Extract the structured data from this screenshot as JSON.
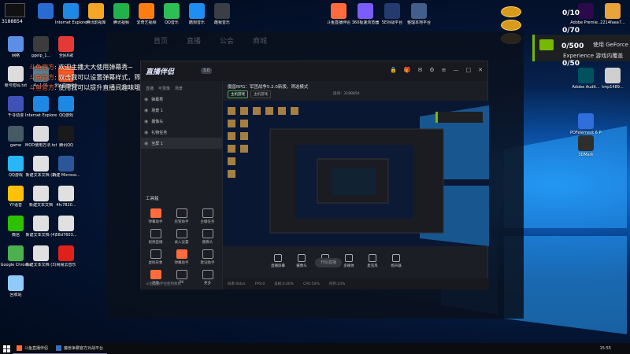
{
  "desktop": {
    "badge": "3188854",
    "left_icons": [
      {
        "label": "",
        "color": "#2a6bd1"
      },
      {
        "label": "Internet Explorer",
        "color": "#1e88e5"
      },
      {
        "label": "腾讯影视库",
        "color": "#f5a623"
      },
      {
        "label": "腾讯视频",
        "color": "#21b24c"
      },
      {
        "label": "爱奇艺视频",
        "color": "#ff7d0f"
      },
      {
        "label": "QQ音乐",
        "color": "#2cbf55"
      },
      {
        "label": "酷狗音乐",
        "color": "#1f8ef1"
      },
      {
        "label": "酷我音乐",
        "color": "#3a3f46"
      },
      {
        "label": "网络",
        "color": "#5c8ee6"
      },
      {
        "label": "ggelp_1...",
        "color": "#3c3c3c"
      },
      {
        "label": "全民K歌",
        "color": "#e53935"
      },
      {
        "label": "帐号密码.txt",
        "color": "#dcdcdc"
      },
      {
        "label": "4+1.91",
        "color": "#607d8b"
      },
      {
        "label": "全民直播助手",
        "color": "#ff5722"
      },
      {
        "label": "千寻动漫",
        "color": "#3f51b5"
      },
      {
        "label": "Internet Explorer",
        "color": "#1e88e5"
      },
      {
        "label": "QQ游戏",
        "color": "#1e88e5"
      },
      {
        "label": "game",
        "color": "#455a64"
      },
      {
        "label": "MOD使用方法.txt",
        "color": "#dcdcdc"
      },
      {
        "label": "腾讯QQ",
        "color": "#1a1a1a"
      },
      {
        "label": "QQ游戏",
        "color": "#29b6f6"
      },
      {
        "label": "新建文本文档 (2)",
        "color": "#e0e0e0"
      },
      {
        "label": "新建 Microso...",
        "color": "#2b579a"
      },
      {
        "label": "YY语音",
        "color": "#ffc107"
      },
      {
        "label": "新建文本文档",
        "color": "#e0e0e0"
      },
      {
        "label": "4fc7820...",
        "color": "#e0e0e0"
      },
      {
        "label": "微信",
        "color": "#2dc100"
      },
      {
        "label": "新建文本文档 (4)",
        "color": "#e0e0e0"
      },
      {
        "label": "58d7603...",
        "color": "#e0e0e0"
      },
      {
        "label": "Google Chrome",
        "color": "#4caf50"
      },
      {
        "label": "新建文本文档 (3)",
        "color": "#e0e0e0"
      },
      {
        "label": "网易云音乐",
        "color": "#e0201b"
      },
      {
        "label": "回收站",
        "color": "#90caf9"
      }
    ],
    "top_icons": [
      {
        "label": "斗鱼直播伴侣",
        "color": "#ff6b3d"
      },
      {
        "label": "360极速浏览器",
        "color": "#7b5cff"
      },
      {
        "label": "5E对战平台",
        "color": "#253b70"
      },
      {
        "label": "整理本地平台",
        "color": "#415f8a"
      }
    ],
    "right_icons": [
      {
        "label": "Adobe Premie...",
        "color": "#2a0a4a"
      },
      {
        "label": "2214faea7...",
        "color": "#e8a33a"
      },
      {
        "label": "Adobe Audit...",
        "color": "#00525f"
      },
      {
        "label": "tmp1489...",
        "color": "#cfcfcf"
      },
      {
        "label": "PDFelement 6 Pro",
        "color": "#2f6edb"
      },
      {
        "label": "3DMark",
        "color": "#2e2e2e"
      }
    ],
    "overlay_counters": [
      "0/10",
      "0/70",
      "0/500",
      "0/50"
    ]
  },
  "nvidia": {
    "line1": "使用 GeForce",
    "line2": "Experience 游戏内覆盖"
  },
  "chat": [
    {
      "name": "斗鱼官方",
      "text": "欢迎主播大大使用弹幕秀~"
    },
    {
      "name": "斗鱼官方",
      "text": "双击我可以设置弹幕样式，筛选指示哦"
    },
    {
      "name": "斗鱼官方",
      "text": "使用我可以提升直播间趣味哦(#^.^#)"
    }
  ],
  "bg_nav": [
    "首页",
    "直播",
    "公会",
    "商城"
  ],
  "app": {
    "brand": "直播伴侣",
    "version": "3.0",
    "panel_tabs": [
      "直播",
      "可录像",
      "场景"
    ],
    "sources": [
      {
        "name": "弹幕秀",
        "active": false
      },
      {
        "name": "场景 1",
        "active": false
      },
      {
        "name": "摄像头",
        "active": false
      },
      {
        "name": "礼物任务",
        "active": false
      },
      {
        "name": "全屏 1",
        "active": true
      }
    ],
    "tools_title": "工具箱",
    "tools": [
      {
        "label": "弹幕助手",
        "hot": true
      },
      {
        "label": "房管助手",
        "hot": false
      },
      {
        "label": "主播任务",
        "hot": false
      },
      {
        "label": "视频直播",
        "hot": false
      },
      {
        "label": "录入设置",
        "hot": false
      },
      {
        "label": "摄像头",
        "hot": false
      },
      {
        "label": "虚拟形象",
        "hot": false
      },
      {
        "label": "弹幕助手",
        "hot": true
      },
      {
        "label": "歌词助手",
        "hot": false
      },
      {
        "label": "连麦",
        "hot": true
      },
      {
        "label": "PK",
        "hot": false
      },
      {
        "label": "更多",
        "hot": false
      }
    ],
    "footer_note": "斗鱼直播伴侣使用教程",
    "stream_title": "魔兽RPG：军团战争5.2.0新版，筛选模式",
    "tags": [
      {
        "label": "主机游戏",
        "sel": true
      },
      {
        "label": "主机游戏",
        "sel": false
      }
    ],
    "room_label": "房间：",
    "room_id": "3188854",
    "controls": [
      "直播屏幕",
      "摄像头",
      "手机投屏",
      "多媒体",
      "麦克风",
      "扬声器"
    ],
    "go_live": "开始直播",
    "status": [
      "码率:0kb/s",
      "FPS:0",
      "丢帧:0.00%",
      "CPU:54%",
      "内存:23%"
    ]
  },
  "taskbar": {
    "tasks": [
      "斗鱼直播伴侣",
      "魔兽争霸官方对战平台"
    ],
    "time": "15:55"
  },
  "colors": {
    "accent": "#ff6b3d",
    "nvidia": "#76b900"
  }
}
